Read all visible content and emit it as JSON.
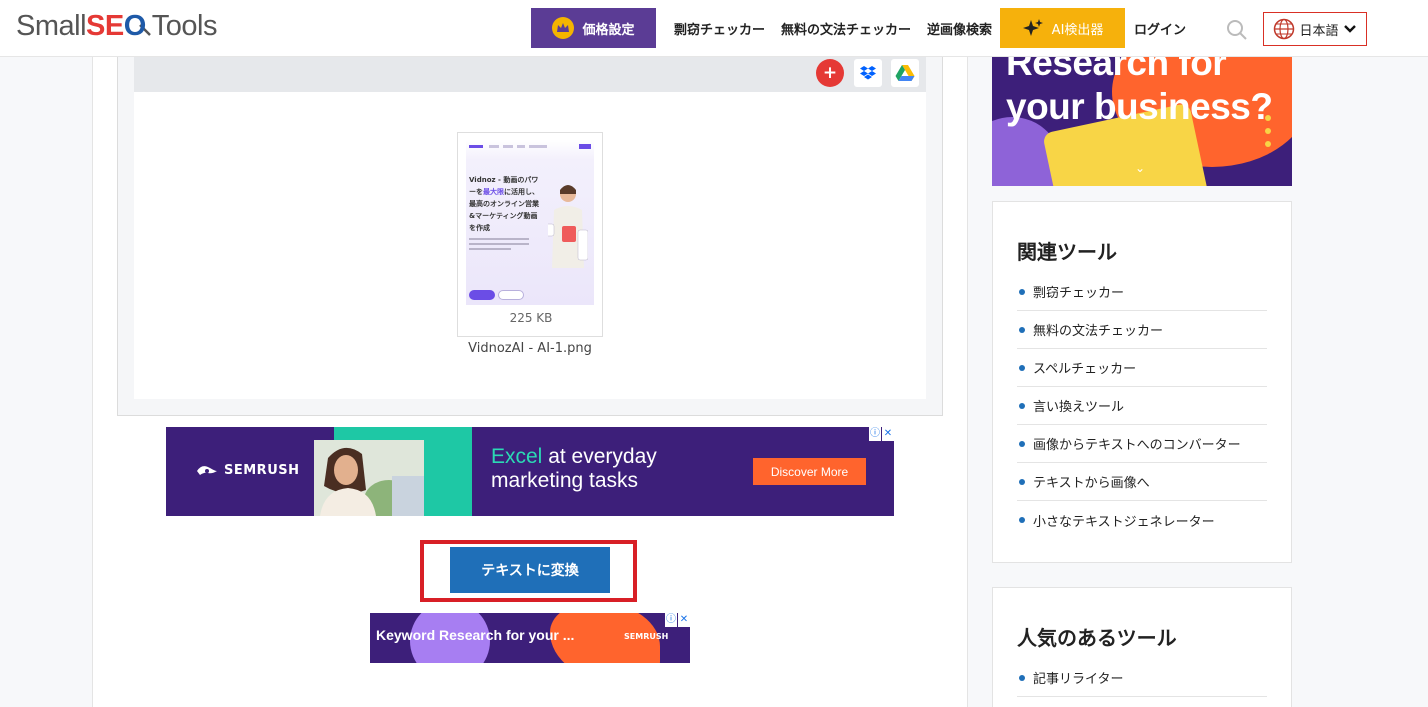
{
  "header": {
    "logo": {
      "small": "Small",
      "seo_s": "S",
      "seo_e": "E",
      "seo_o": "O",
      "tools": "Tools"
    },
    "pricing_label": "価格設定",
    "nav_links": [
      "剽窃チェッカー",
      "無料の文法チェッカー",
      "逆画像検索"
    ],
    "ai_detector_label": "AI検出器",
    "login_label": "ログイン",
    "language_label": "日本語"
  },
  "upload": {
    "file_name": "VidnozAI - AI-1.png",
    "file_size": "225 KB",
    "thumb_text_1": "Vidnoz - 動画のパワーを",
    "thumb_text_hl": "最大限",
    "thumb_text_2": "に活用し、最高のオンライン営業&マーケティング動画を作成"
  },
  "ad_banner": {
    "brand": "SEMRUSH",
    "headline_accent": "Excel",
    "headline_rest": " at everyday",
    "headline_line2": "marketing tasks",
    "cta": "Discover More"
  },
  "convert_button_label": "テキストに変換",
  "ad_small": {
    "text": "Keyword Research for your ...",
    "brand": "SEMRUSH"
  },
  "sidebar_ad": {
    "line1": "Research for",
    "line2": "your business?"
  },
  "related_tools": {
    "title": "関連ツール",
    "items": [
      "剽窃チェッカー",
      "無料の文法チェッカー",
      "スペルチェッカー",
      "言い換えツール",
      "画像からテキストへのコンバーター",
      "テキストから画像へ",
      "小さなテキストジェネレーター"
    ]
  },
  "popular_tools": {
    "title": "人気のあるツール",
    "items": [
      "記事リライター"
    ]
  },
  "colors": {
    "pricing_bg": "#5b3c95",
    "ai_bg": "#f6b10c",
    "convert_bg": "#1f6fb8",
    "highlight_border": "#d81f26",
    "semrush_purple": "#3d1f7a",
    "semrush_orange": "#ff642d"
  }
}
